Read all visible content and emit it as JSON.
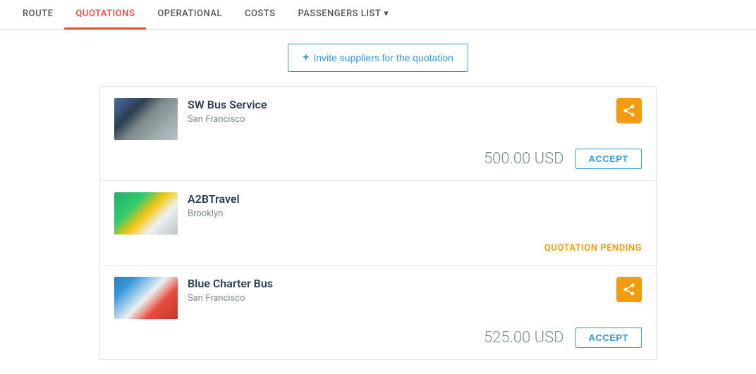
{
  "nav": {
    "tabs": [
      {
        "id": "route",
        "label": "ROUTE",
        "active": false
      },
      {
        "id": "quotations",
        "label": "QUOTATIONS",
        "active": true
      },
      {
        "id": "operational",
        "label": "OPERATIONAL",
        "active": false
      },
      {
        "id": "costs",
        "label": "COSTS",
        "active": false
      },
      {
        "id": "passengers_list",
        "label": "PASSENGERS LIST",
        "active": false,
        "has_arrow": true
      }
    ]
  },
  "invite_button": {
    "label": "Invite suppliers for the quotation",
    "plus_icon": "+"
  },
  "suppliers": [
    {
      "id": "sw-bus-service",
      "name": "SW Bus Service",
      "location": "San Francisco",
      "has_share_icon": true,
      "price": "500.00 USD",
      "action": "ACCEPT",
      "status": null,
      "img_class": "bus-img-1"
    },
    {
      "id": "a2b-travel",
      "name": "A2BTravel",
      "location": "Brooklyn",
      "has_share_icon": false,
      "price": null,
      "action": null,
      "status": "QUOTATION PENDING",
      "img_class": "bus-img-2"
    },
    {
      "id": "blue-charter-bus",
      "name": "Blue Charter Bus",
      "location": "San Francisco",
      "has_share_icon": true,
      "price": "525.00 USD",
      "action": "ACCEPT",
      "status": null,
      "img_class": "bus-img-3"
    }
  ],
  "icons": {
    "share": "share-icon",
    "chevron_down": "▾",
    "plus": "+"
  }
}
